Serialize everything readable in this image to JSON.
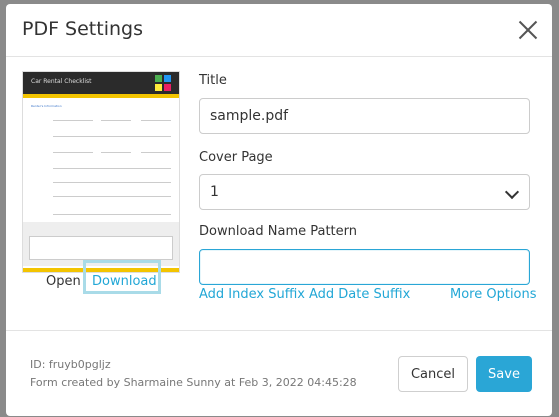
{
  "dialog": {
    "title": "PDF Settings"
  },
  "preview": {
    "header_title": "Car Rental Checklist",
    "section_heading": "Renter's Information",
    "open_label": "Open",
    "download_label": "Download"
  },
  "form": {
    "title_label": "Title",
    "title_value": "sample.pdf",
    "cover_label": "Cover Page",
    "cover_value": "1",
    "pattern_label": "Download Name Pattern",
    "pattern_value": "",
    "links": {
      "index_suffix": "Add Index Suffix",
      "date_suffix": "Add Date Suffix",
      "more_options": "More Options"
    }
  },
  "footer": {
    "id_text": "ID: fruyb0pgljz",
    "created_text": "Form created by Sharmaine Sunny at Feb 3, 2022 04:45:28",
    "cancel_label": "Cancel",
    "save_label": "Save"
  },
  "colors": {
    "accent": "#2aa6d6",
    "yellow": "#f3c400"
  }
}
